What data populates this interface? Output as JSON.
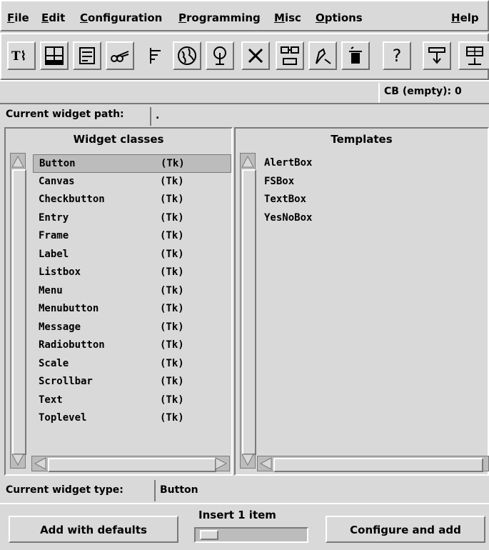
{
  "menubar": {
    "items": [
      {
        "label": "File"
      },
      {
        "label": "Edit"
      },
      {
        "label": "Configuration"
      },
      {
        "label": "Programming"
      },
      {
        "label": "Misc"
      },
      {
        "label": "Options"
      },
      {
        "label": "Help"
      }
    ]
  },
  "toolbar": {
    "icons": [
      "text-tool-icon",
      "grid-layout-icon",
      "form-icon",
      "scissors-icon",
      "tree-list-icon",
      "globe-icon",
      "tree-icon",
      "cut-x-icon",
      "move-down-icon",
      "pen-icon",
      "trash-icon",
      "help-question-icon",
      "drop-icon",
      "table-icon"
    ],
    "help_glyph": "?",
    "x_glyph": "✕"
  },
  "status": {
    "cb_label": "CB (empty): 0"
  },
  "path": {
    "label": "Current widget path:",
    "value": "."
  },
  "widget_classes": {
    "header": "Widget classes",
    "rows": [
      {
        "name": "Button",
        "kind": "(Tk)"
      },
      {
        "name": "Canvas",
        "kind": "(Tk)"
      },
      {
        "name": "Checkbutton",
        "kind": "(Tk)"
      },
      {
        "name": "Entry",
        "kind": "(Tk)"
      },
      {
        "name": "Frame",
        "kind": "(Tk)"
      },
      {
        "name": "Label",
        "kind": "(Tk)"
      },
      {
        "name": "Listbox",
        "kind": "(Tk)"
      },
      {
        "name": "Menu",
        "kind": "(Tk)"
      },
      {
        "name": "Menubutton",
        "kind": "(Tk)"
      },
      {
        "name": "Message",
        "kind": "(Tk)"
      },
      {
        "name": "Radiobutton",
        "kind": "(Tk)"
      },
      {
        "name": "Scale",
        "kind": "(Tk)"
      },
      {
        "name": "Scrollbar",
        "kind": "(Tk)"
      },
      {
        "name": "Text",
        "kind": "(Tk)"
      },
      {
        "name": "Toplevel",
        "kind": "(Tk)"
      }
    ]
  },
  "templates": {
    "header": "Templates",
    "rows": [
      "AlertBox",
      "FSBox",
      "TextBox",
      "YesNoBox"
    ]
  },
  "type": {
    "label": "Current widget type:",
    "value": "Button"
  },
  "bottom": {
    "add_defaults": "Add with defaults",
    "insert_label": "Insert 1 item",
    "configure_add": "Configure and add"
  }
}
